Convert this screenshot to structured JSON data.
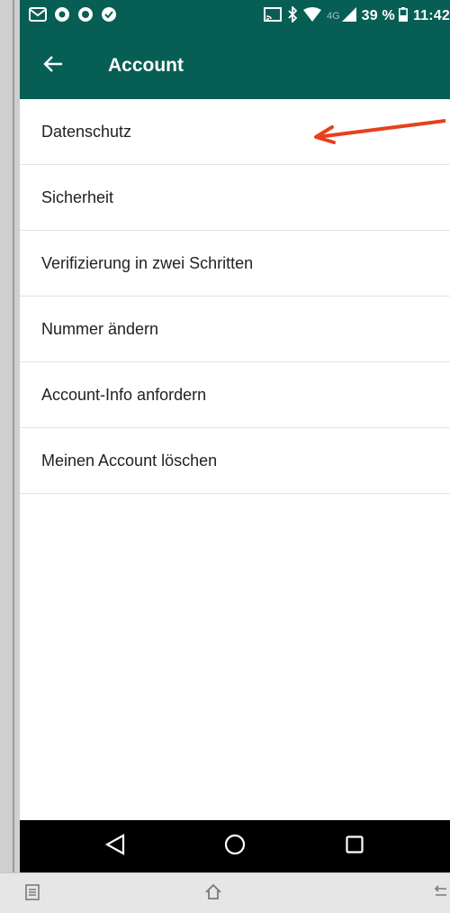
{
  "status_bar": {
    "battery": "39 %",
    "time": "11:42",
    "network": "4G"
  },
  "app_bar": {
    "title": "Account"
  },
  "menu": {
    "items": [
      {
        "label": "Datenschutz"
      },
      {
        "label": "Sicherheit"
      },
      {
        "label": "Verifizierung in zwei Schritten"
      },
      {
        "label": "Nummer ändern"
      },
      {
        "label": "Account-Info anfordern"
      },
      {
        "label": "Meinen Account löschen"
      }
    ]
  },
  "colors": {
    "primary": "#075e54",
    "annotation_arrow": "#e8401c",
    "nav_bar": "#000000"
  },
  "icons": {
    "back": "arrow-left-icon",
    "nav_back": "triangle-back-icon",
    "nav_home": "circle-home-icon",
    "nav_recents": "square-recents-icon"
  }
}
